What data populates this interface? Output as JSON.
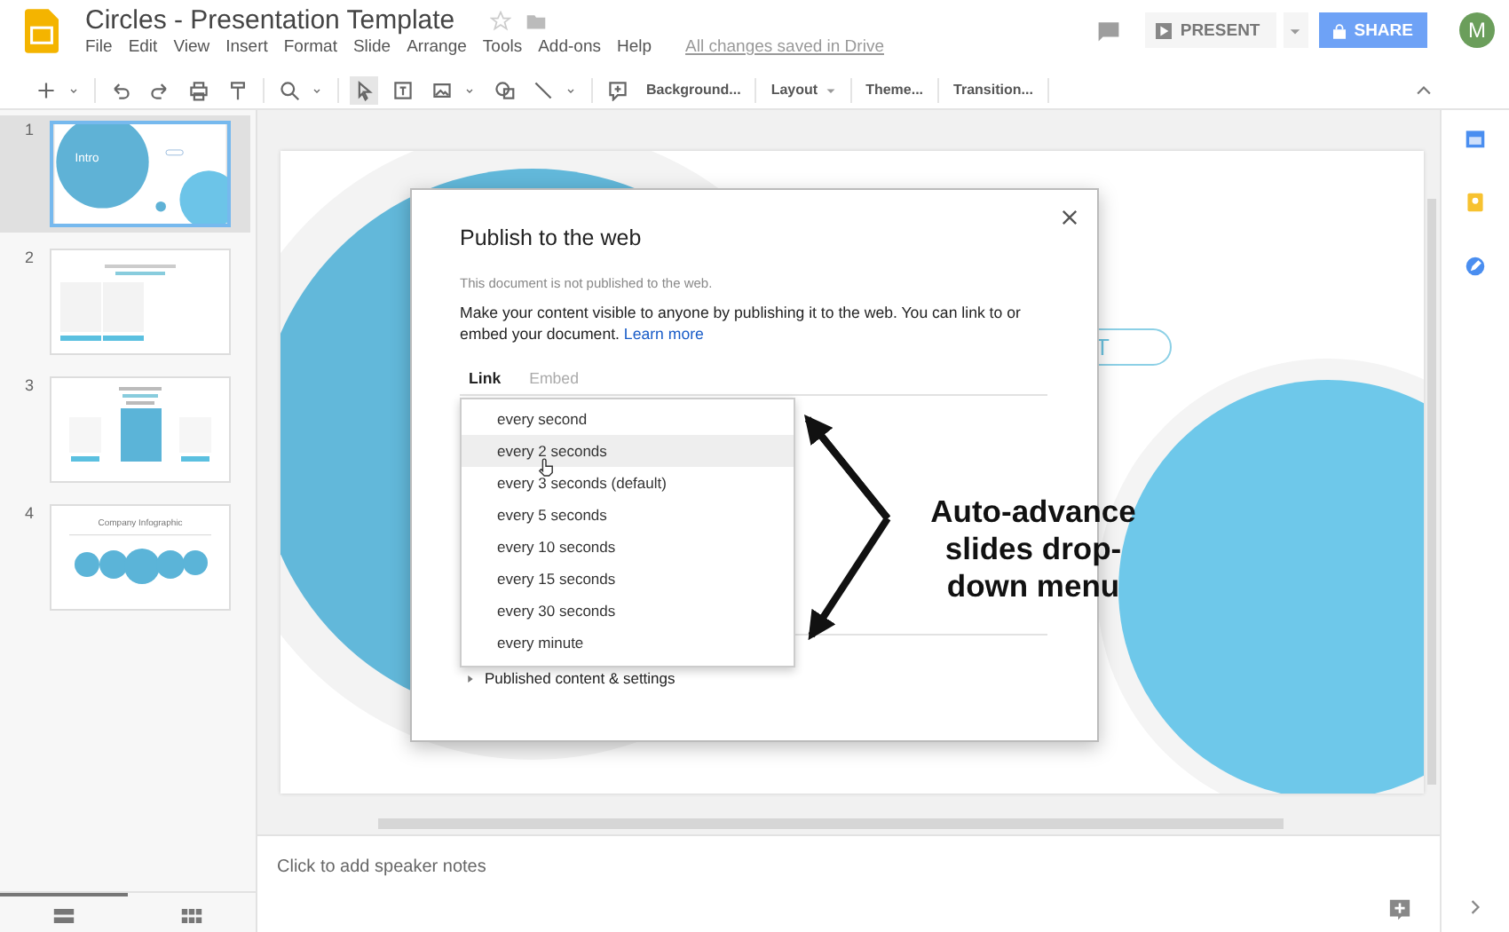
{
  "header": {
    "title": "Circles - Presentation Template",
    "menu": [
      "File",
      "Edit",
      "View",
      "Insert",
      "Format",
      "Slide",
      "Arrange",
      "Tools",
      "Add-ons",
      "Help"
    ],
    "save_status": "All changes saved in Drive",
    "present_button": "PRESENT",
    "share_button": "SHARE",
    "avatar": "M"
  },
  "toolbar": {
    "buttons": [
      {
        "label": "Background...",
        "caret": false
      },
      {
        "label": "Layout",
        "caret": true
      },
      {
        "label": "Theme...",
        "caret": false
      },
      {
        "label": "Transition...",
        "caret": false
      }
    ]
  },
  "filmstrip": {
    "slides": [
      {
        "number": "1",
        "kind": "intro",
        "title": "Intro",
        "selected": true
      },
      {
        "number": "2",
        "kind": "cards",
        "selected": false
      },
      {
        "number": "3",
        "kind": "pricing",
        "selected": false
      },
      {
        "number": "4",
        "kind": "infographic",
        "title": "Company Infographic",
        "selected": false
      }
    ],
    "views": [
      {
        "kind": "list",
        "selected": true
      },
      {
        "kind": "grid",
        "selected": false
      }
    ]
  },
  "slide": {
    "button_text": "T"
  },
  "dialog": {
    "title": "Publish to the web",
    "status": "This document is not published to the web.",
    "description": "Make your content visible to anyone by publishing it to the web. You can link to or embed your document.",
    "link": "Learn more",
    "tabs": [
      {
        "label": "Link",
        "selected": true
      },
      {
        "label": "Embed",
        "selected": false
      }
    ],
    "dropdown": [
      {
        "label": "every second",
        "selected": false
      },
      {
        "label": "every 2 seconds",
        "selected": true
      },
      {
        "label": "every 3 seconds (default)",
        "selected": false
      },
      {
        "label": "every 5 seconds",
        "selected": false
      },
      {
        "label": "every 10 seconds",
        "selected": false
      },
      {
        "label": "every 15 seconds",
        "selected": false
      },
      {
        "label": "every 30 seconds",
        "selected": false
      },
      {
        "label": "every minute",
        "selected": false
      }
    ],
    "section": "Published content & settings"
  },
  "annotation": "Auto-advance slides drop-down menu",
  "speaker_notes": {
    "placeholder": "Click to add speaker notes"
  }
}
